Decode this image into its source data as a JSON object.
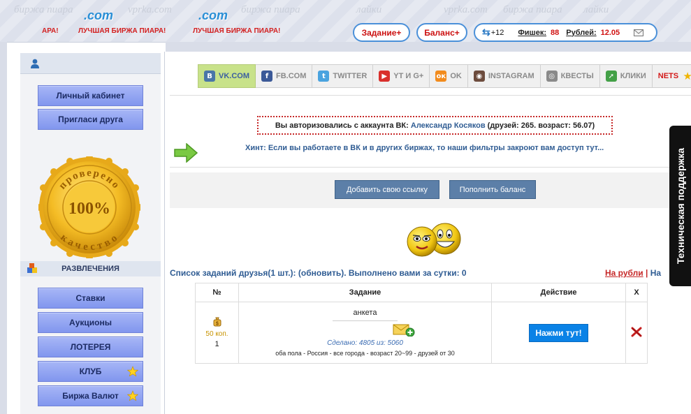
{
  "header": {
    "watermarks": [
      "биржа пиара",
      "vprka.com",
      "биржа пиара",
      "лайки",
      "vprka.com",
      "лайки",
      "биржа пиара"
    ],
    "logo_com": ".com",
    "logo_tag": "ЛУЧШАЯ БИРЖА ПИАРА!",
    "logo_left_fragment": "АРА!",
    "task_button": "Задание+",
    "balance_button": "Баланс+",
    "notify_count": "+12",
    "chips_label": "Фишек:",
    "chips_value": "88",
    "rubles_label": "Рублей:",
    "rubles_value": "12.05"
  },
  "sidebar": {
    "top_buttons": [
      "Личный кабинет",
      "Пригласи друга"
    ],
    "seal": {
      "top_text": "проверено",
      "bottom_text": "качество",
      "center": "100%"
    },
    "fun_header": "РАЗВЛЕЧЕНИЯ",
    "fun_buttons": [
      {
        "label": "Ставки",
        "star": false
      },
      {
        "label": "Аукционы",
        "star": false
      },
      {
        "label": "ЛОТЕРЕЯ",
        "star": false
      },
      {
        "label": "КЛУБ",
        "star": true
      },
      {
        "label": "Биржа Валют",
        "star": true
      }
    ]
  },
  "tabs": [
    {
      "label": "VK.COM",
      "icon": "vk-icon",
      "glyph": "В",
      "color": "#4a76a8",
      "active": true
    },
    {
      "label": "FB.COM",
      "icon": "facebook-icon",
      "glyph": "f",
      "color": "#3b5998",
      "active": false
    },
    {
      "label": "TWITTER",
      "icon": "twitter-icon",
      "glyph": "t",
      "color": "#4aa3df",
      "active": false
    },
    {
      "label": "YT И G+",
      "icon": "youtube-icon",
      "glyph": "▶",
      "color": "#d9302c",
      "active": false
    },
    {
      "label": "OK",
      "icon": "odnoklassniki-icon",
      "glyph": "ок",
      "color": "#f28b1d",
      "active": false
    },
    {
      "label": "INSTAGRAM",
      "icon": "instagram-icon",
      "glyph": "◉",
      "color": "#6d4c3d",
      "active": false
    },
    {
      "label": "КВЕСТЫ",
      "icon": "eye-icon",
      "glyph": "◎",
      "color": "#8a8a8a",
      "active": false
    },
    {
      "label": "КЛИКИ",
      "icon": "cursor-icon",
      "glyph": "➚",
      "color": "#43a047",
      "active": false
    },
    {
      "label": "NETS",
      "icon": "star-icon",
      "glyph": "★",
      "color": "#f0b400",
      "active": false
    }
  ],
  "auth": {
    "prefix": "Вы авторизовались с аккаунта ВК:",
    "name": "Александр Косяков",
    "suffix": "(друзей: 265. возраст: 56.07)"
  },
  "hint": "Хинт: Если вы работаете в ВК и в других биржах, то наши фильтры закроют вам доступ тут...",
  "actions": {
    "add_link": "Добавить свою ссылку",
    "top_up": "Пополнить баланс"
  },
  "list": {
    "title": "Список заданий друзья(1 шт.): (обновить). Выполнено вами за сутки: 0",
    "link_rubles": "На рубли",
    "separator": "|",
    "link_other": "На"
  },
  "table": {
    "headers": [
      "№",
      "Задание",
      "Действие",
      "X"
    ],
    "row": {
      "price": "50 коп.",
      "number": "1",
      "task": "анкета",
      "done": "Сделано: 4805 из: 5060",
      "filters": "оба пола - Россия - все города - возраст 20~99 - друзей от 30",
      "action": "Нажми тут!"
    }
  },
  "support": "Техническая поддержка"
}
